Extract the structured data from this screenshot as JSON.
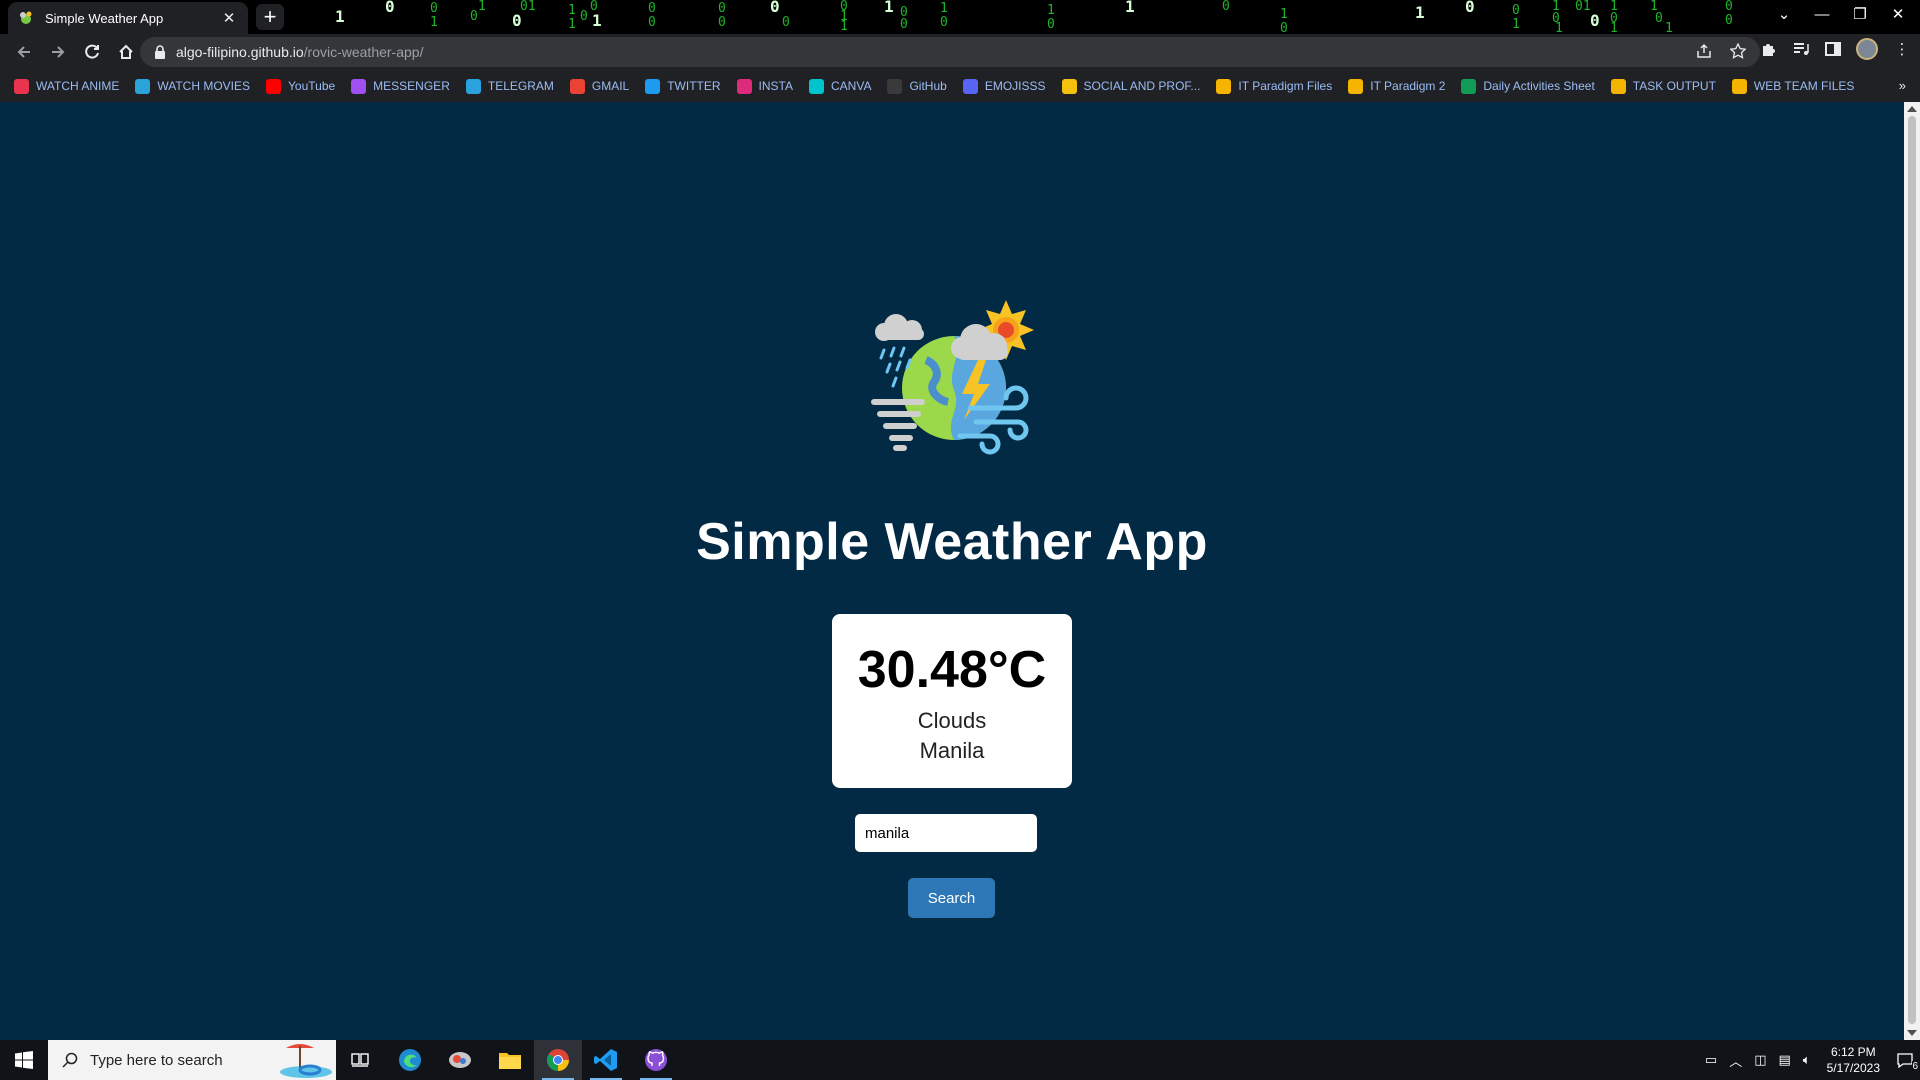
{
  "browser": {
    "tab_title": "Simple Weather App",
    "tab_close": "✕",
    "new_tab": "+",
    "url_host": "algo-filipino.github.io",
    "url_path": "/rovic-weather-app/",
    "window_controls": {
      "chevron": "⌄",
      "minimize": "—",
      "restore": "❐",
      "close": "✕"
    }
  },
  "bookmarks": [
    {
      "label": "WATCH ANIME",
      "color": "#e8344e",
      "icon": "anime-icon"
    },
    {
      "label": "WATCH MOVIES",
      "color": "#2aa3d8",
      "icon": "movies-icon"
    },
    {
      "label": "YouTube",
      "color": "#ff0000",
      "icon": "youtube-icon"
    },
    {
      "label": "MESSENGER",
      "color": "#a050f0",
      "icon": "messenger-icon"
    },
    {
      "label": "TELEGRAM",
      "color": "#2aa2de",
      "icon": "telegram-icon"
    },
    {
      "label": "GMAIL",
      "color": "#ea4335",
      "icon": "gmail-icon"
    },
    {
      "label": "TWITTER",
      "color": "#1d9bf0",
      "icon": "twitter-icon"
    },
    {
      "label": "INSTA",
      "color": "#dd2a7b",
      "icon": "instagram-icon"
    },
    {
      "label": "CANVA",
      "color": "#00c4cc",
      "icon": "canva-icon"
    },
    {
      "label": "GitHub",
      "color": "#3a3a3a",
      "icon": "github-icon"
    },
    {
      "label": "EMOJISSS",
      "color": "#5865f2",
      "icon": "emoji-icon"
    },
    {
      "label": "SOCIAL AND PROF...",
      "color": "#f4c20d",
      "icon": "folder-icon"
    },
    {
      "label": "IT Paradigm Files",
      "color": "#f4b400",
      "icon": "drive-icon"
    },
    {
      "label": "IT Paradigm 2",
      "color": "#f4b400",
      "icon": "drive-icon"
    },
    {
      "label": "Daily Activities Sheet",
      "color": "#0f9d58",
      "icon": "sheets-icon"
    },
    {
      "label": "TASK OUTPUT",
      "color": "#f4b400",
      "icon": "drive-icon"
    },
    {
      "label": "WEB TEAM FILES",
      "color": "#f4b400",
      "icon": "drive-icon"
    }
  ],
  "bookmarks_more": "»",
  "app": {
    "title": "Simple Weather App",
    "temperature": "30.48°C",
    "description": "Clouds",
    "city": "Manila",
    "search_value": "manila",
    "search_button": "Search"
  },
  "taskbar": {
    "search_placeholder": "Type here to search",
    "time": "6:12 PM",
    "date": "5/17/2023",
    "notification_count": "6"
  },
  "colors": {
    "page_background": "#022a44",
    "button": "#2d77b7",
    "card": "#ffffff"
  }
}
